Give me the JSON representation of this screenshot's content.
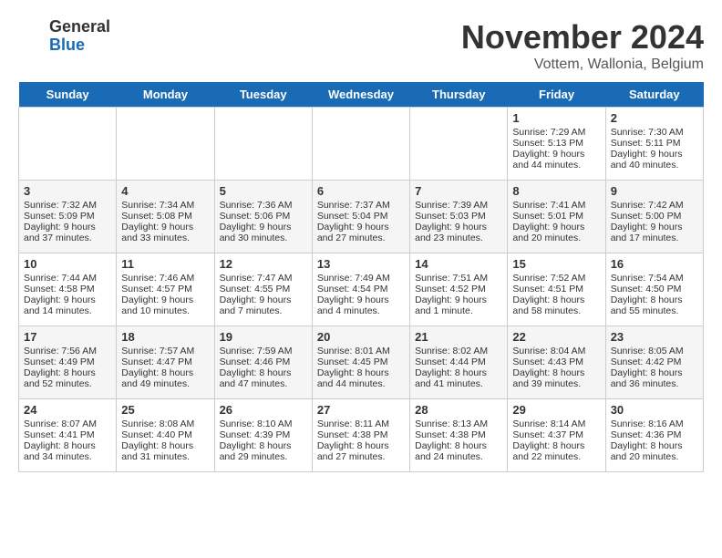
{
  "logo": {
    "general": "General",
    "blue": "Blue"
  },
  "title": "November 2024",
  "subtitle": "Vottem, Wallonia, Belgium",
  "days_of_week": [
    "Sunday",
    "Monday",
    "Tuesday",
    "Wednesday",
    "Thursday",
    "Friday",
    "Saturday"
  ],
  "weeks": [
    [
      {
        "day": "",
        "info": ""
      },
      {
        "day": "",
        "info": ""
      },
      {
        "day": "",
        "info": ""
      },
      {
        "day": "",
        "info": ""
      },
      {
        "day": "",
        "info": ""
      },
      {
        "day": "1",
        "info": "Sunrise: 7:29 AM\nSunset: 5:13 PM\nDaylight: 9 hours and 44 minutes."
      },
      {
        "day": "2",
        "info": "Sunrise: 7:30 AM\nSunset: 5:11 PM\nDaylight: 9 hours and 40 minutes."
      }
    ],
    [
      {
        "day": "3",
        "info": "Sunrise: 7:32 AM\nSunset: 5:09 PM\nDaylight: 9 hours and 37 minutes."
      },
      {
        "day": "4",
        "info": "Sunrise: 7:34 AM\nSunset: 5:08 PM\nDaylight: 9 hours and 33 minutes."
      },
      {
        "day": "5",
        "info": "Sunrise: 7:36 AM\nSunset: 5:06 PM\nDaylight: 9 hours and 30 minutes."
      },
      {
        "day": "6",
        "info": "Sunrise: 7:37 AM\nSunset: 5:04 PM\nDaylight: 9 hours and 27 minutes."
      },
      {
        "day": "7",
        "info": "Sunrise: 7:39 AM\nSunset: 5:03 PM\nDaylight: 9 hours and 23 minutes."
      },
      {
        "day": "8",
        "info": "Sunrise: 7:41 AM\nSunset: 5:01 PM\nDaylight: 9 hours and 20 minutes."
      },
      {
        "day": "9",
        "info": "Sunrise: 7:42 AM\nSunset: 5:00 PM\nDaylight: 9 hours and 17 minutes."
      }
    ],
    [
      {
        "day": "10",
        "info": "Sunrise: 7:44 AM\nSunset: 4:58 PM\nDaylight: 9 hours and 14 minutes."
      },
      {
        "day": "11",
        "info": "Sunrise: 7:46 AM\nSunset: 4:57 PM\nDaylight: 9 hours and 10 minutes."
      },
      {
        "day": "12",
        "info": "Sunrise: 7:47 AM\nSunset: 4:55 PM\nDaylight: 9 hours and 7 minutes."
      },
      {
        "day": "13",
        "info": "Sunrise: 7:49 AM\nSunset: 4:54 PM\nDaylight: 9 hours and 4 minutes."
      },
      {
        "day": "14",
        "info": "Sunrise: 7:51 AM\nSunset: 4:52 PM\nDaylight: 9 hours and 1 minute."
      },
      {
        "day": "15",
        "info": "Sunrise: 7:52 AM\nSunset: 4:51 PM\nDaylight: 8 hours and 58 minutes."
      },
      {
        "day": "16",
        "info": "Sunrise: 7:54 AM\nSunset: 4:50 PM\nDaylight: 8 hours and 55 minutes."
      }
    ],
    [
      {
        "day": "17",
        "info": "Sunrise: 7:56 AM\nSunset: 4:49 PM\nDaylight: 8 hours and 52 minutes."
      },
      {
        "day": "18",
        "info": "Sunrise: 7:57 AM\nSunset: 4:47 PM\nDaylight: 8 hours and 49 minutes."
      },
      {
        "day": "19",
        "info": "Sunrise: 7:59 AM\nSunset: 4:46 PM\nDaylight: 8 hours and 47 minutes."
      },
      {
        "day": "20",
        "info": "Sunrise: 8:01 AM\nSunset: 4:45 PM\nDaylight: 8 hours and 44 minutes."
      },
      {
        "day": "21",
        "info": "Sunrise: 8:02 AM\nSunset: 4:44 PM\nDaylight: 8 hours and 41 minutes."
      },
      {
        "day": "22",
        "info": "Sunrise: 8:04 AM\nSunset: 4:43 PM\nDaylight: 8 hours and 39 minutes."
      },
      {
        "day": "23",
        "info": "Sunrise: 8:05 AM\nSunset: 4:42 PM\nDaylight: 8 hours and 36 minutes."
      }
    ],
    [
      {
        "day": "24",
        "info": "Sunrise: 8:07 AM\nSunset: 4:41 PM\nDaylight: 8 hours and 34 minutes."
      },
      {
        "day": "25",
        "info": "Sunrise: 8:08 AM\nSunset: 4:40 PM\nDaylight: 8 hours and 31 minutes."
      },
      {
        "day": "26",
        "info": "Sunrise: 8:10 AM\nSunset: 4:39 PM\nDaylight: 8 hours and 29 minutes."
      },
      {
        "day": "27",
        "info": "Sunrise: 8:11 AM\nSunset: 4:38 PM\nDaylight: 8 hours and 27 minutes."
      },
      {
        "day": "28",
        "info": "Sunrise: 8:13 AM\nSunset: 4:38 PM\nDaylight: 8 hours and 24 minutes."
      },
      {
        "day": "29",
        "info": "Sunrise: 8:14 AM\nSunset: 4:37 PM\nDaylight: 8 hours and 22 minutes."
      },
      {
        "day": "30",
        "info": "Sunrise: 8:16 AM\nSunset: 4:36 PM\nDaylight: 8 hours and 20 minutes."
      }
    ]
  ]
}
